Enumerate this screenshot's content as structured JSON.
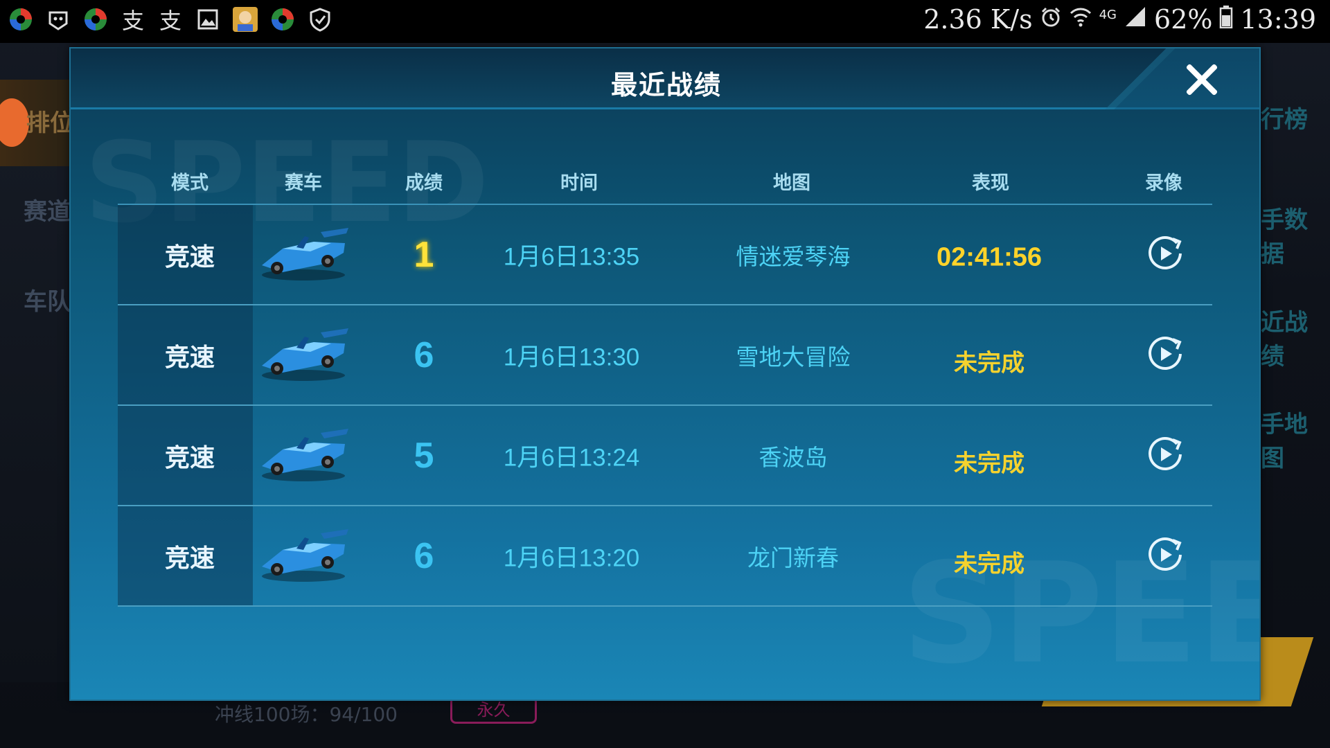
{
  "status_bar": {
    "left_icons": [
      "app-icon",
      "app-icon",
      "app-icon",
      "alipay-icon",
      "alipay-icon",
      "gallery-icon",
      "avatar-icon",
      "app-icon",
      "shield-icon"
    ],
    "speed": "2.36 K/s",
    "network": "4G",
    "battery": "62%",
    "clock": "13:39"
  },
  "background": {
    "sidebar_items": [
      "排位",
      "赛道",
      "车队"
    ],
    "right_items": [
      "行榜",
      "手数据",
      "近战绩",
      "手地图"
    ],
    "footer": "冲线100场：94/100",
    "footer_badge": "永久"
  },
  "modal": {
    "title": "最近战绩",
    "watermark": "SPEED",
    "columns": [
      "模式",
      "赛车",
      "成绩",
      "时间",
      "地图",
      "表现",
      "录像"
    ],
    "rows": [
      {
        "mode": "竞速",
        "rank": "1",
        "time": "1月6日13:35",
        "map": "情迷爱琴海",
        "performance": "02:41:56"
      },
      {
        "mode": "竞速",
        "rank": "6",
        "time": "1月6日13:30",
        "map": "雪地大冒险",
        "performance": "未完成"
      },
      {
        "mode": "竞速",
        "rank": "5",
        "time": "1月6日13:24",
        "map": "香波岛",
        "performance": "未完成"
      },
      {
        "mode": "竞速",
        "rank": "6",
        "time": "1月6日13:20",
        "map": "龙门新春",
        "performance": "未完成"
      }
    ]
  },
  "colors": {
    "rank_first": "#ffe23a",
    "rank_other": "#3bc4f2",
    "text_cyan": "#4dd3f5",
    "text_gold": "#f5d22e"
  }
}
